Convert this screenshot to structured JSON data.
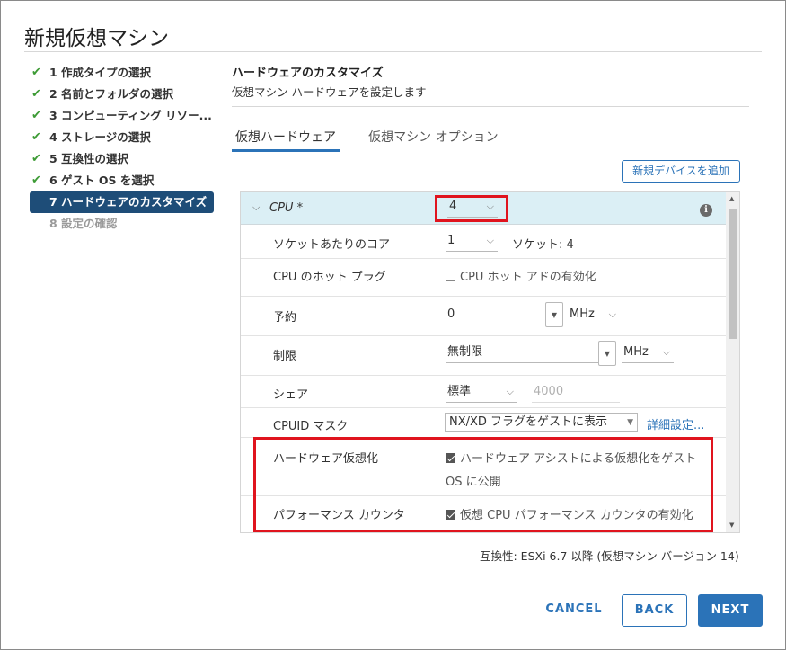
{
  "window": {
    "title": "新規仮想マシン"
  },
  "steps": [
    {
      "label": "1 作成タイプの選択",
      "state": "done"
    },
    {
      "label": "2 名前とフォルダの選択",
      "state": "done"
    },
    {
      "label": "3 コンピューティング リソー...",
      "state": "done"
    },
    {
      "label": "4 ストレージの選択",
      "state": "done"
    },
    {
      "label": "5 互換性の選択",
      "state": "done"
    },
    {
      "label": "6 ゲスト OS を選択",
      "state": "done"
    },
    {
      "label": "7 ハードウェアのカスタマイズ",
      "state": "active"
    },
    {
      "label": "8 設定の確認",
      "state": "disabled"
    }
  ],
  "content": {
    "title": "ハードウェアのカスタマイズ",
    "subtitle": "仮想マシン ハードウェアを設定します",
    "tabs": [
      {
        "label": "仮想ハードウェア",
        "active": true
      },
      {
        "label": "仮想マシン オプション",
        "active": false
      }
    ],
    "add_device_label": "新規デバイスを追加"
  },
  "cpu": {
    "label": "CPU *",
    "value": "4",
    "cores_label": "ソケットあたりのコア",
    "cores_value": "1",
    "sockets_text": "ソケット: 4",
    "hotplug_label": "CPU のホット プラグ",
    "hotplug_checkbox": "CPU ホット アドの有効化",
    "hotplug_checked": false,
    "reservation_label": "予約",
    "reservation_value": "0",
    "reservation_unit": "MHz",
    "limit_label": "制限",
    "limit_value": "無制限",
    "limit_unit": "MHz",
    "shares_label": "シェア",
    "shares_value": "標準",
    "shares_number": "4000",
    "cpuid_label": "CPUID マスク",
    "cpuid_value": "NX/XD フラグをゲストに表示",
    "cpuid_link": "詳細設定...",
    "hwvirt_label": "ハードウェア仮想化",
    "hwvirt_text_line1": "ハードウェア アシストによる仮想化をゲスト",
    "hwvirt_text_line2": "OS に公開",
    "hwvirt_checked": true,
    "perfcounter_label": "パフォーマンス カウンタ",
    "perfcounter_text": "仮想 CPU パフォーマンス カウンタの有効化",
    "perfcounter_checked": true
  },
  "compatibility": "互換性: ESXi 6.7 以降 (仮想マシン バージョン 14)",
  "footer": {
    "cancel": "CANCEL",
    "back": "BACK",
    "next": "NEXT"
  },
  "colors": {
    "accent": "#2b73b8",
    "active_step_bg": "#1e4d78",
    "check": "#3d9b35",
    "highlight_box": "#e0141e",
    "cpu_header_bg": "#dbeff5"
  },
  "icons": {
    "step_done": "check-icon",
    "expand": "chevron-down-icon",
    "info": "info-icon"
  }
}
